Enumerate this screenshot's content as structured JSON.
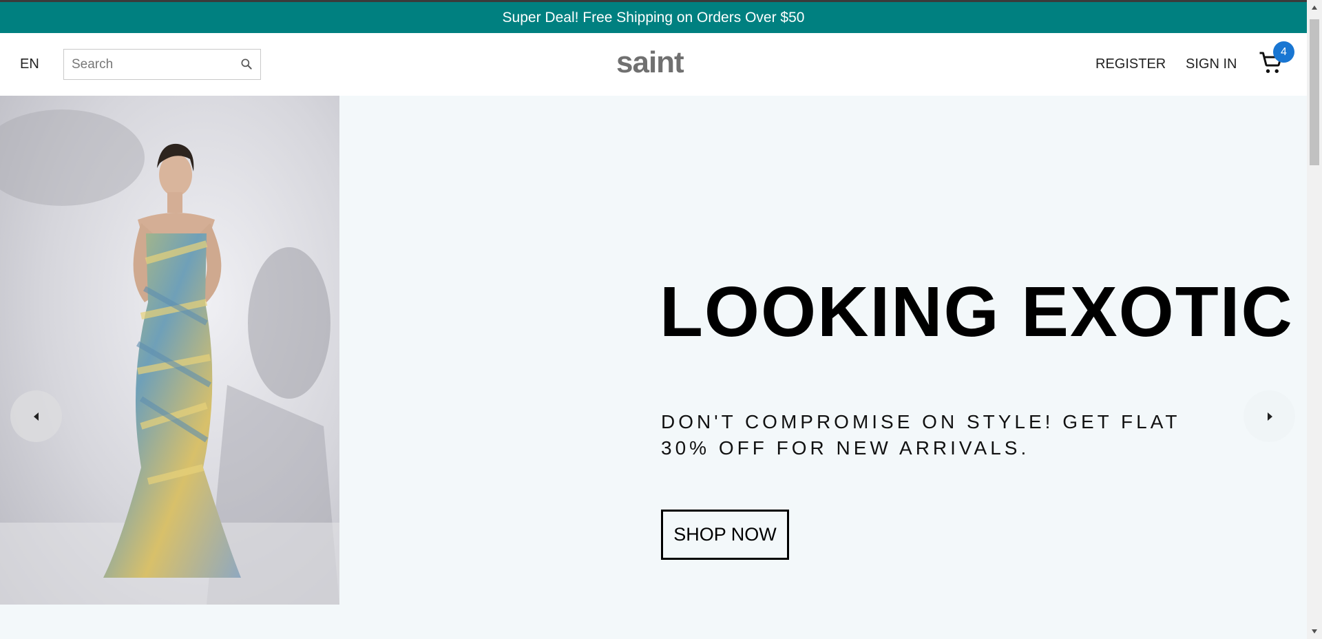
{
  "announcement": {
    "text": "Super Deal! Free Shipping on Orders Over $50"
  },
  "header": {
    "language": "EN",
    "search": {
      "placeholder": "Search",
      "value": ""
    },
    "logo": "saint",
    "register_label": "REGISTER",
    "signin_label": "SIGN IN",
    "cart_count": "4"
  },
  "hero": {
    "title": "LOOKING EXOTIC",
    "subtitle": "DON'T COMPROMISE ON STYLE! GET FLAT 30% OFF FOR NEW ARRIVALS.",
    "cta_label": "SHOP NOW"
  },
  "colors": {
    "announcement_bg": "#008080",
    "hero_bg": "#f3f8fa",
    "cart_badge": "#1976d2"
  },
  "icons": [
    "search-icon",
    "cart-icon",
    "chevron-left-icon",
    "chevron-right-icon"
  ]
}
